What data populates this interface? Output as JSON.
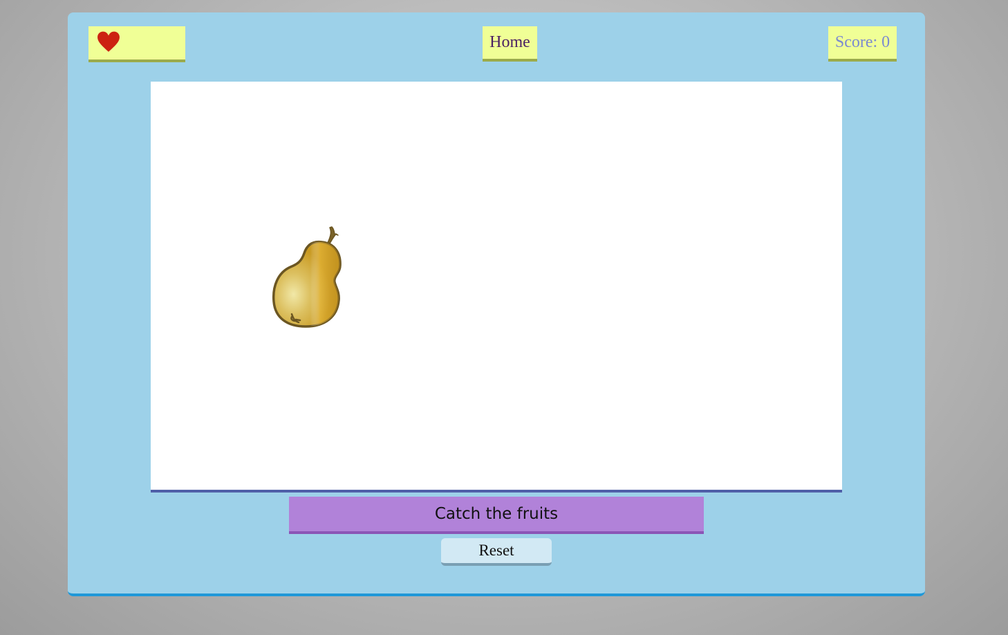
{
  "game": {
    "lives": {
      "icon": "heart-icon",
      "count": 1,
      "color": "#cc2211"
    },
    "home_label": "Home",
    "score_text": "Score: 0",
    "score": 0,
    "falling_items": [
      {
        "fruit": "pear",
        "icon": "pear-icon"
      }
    ],
    "message": "Catch the fruits",
    "reset_label": "Reset"
  },
  "colors": {
    "frame": "#9dd1e9",
    "panel_yellow": "#f0ff96",
    "message_bar": "#b182d9",
    "canvas": "#ffffff"
  }
}
